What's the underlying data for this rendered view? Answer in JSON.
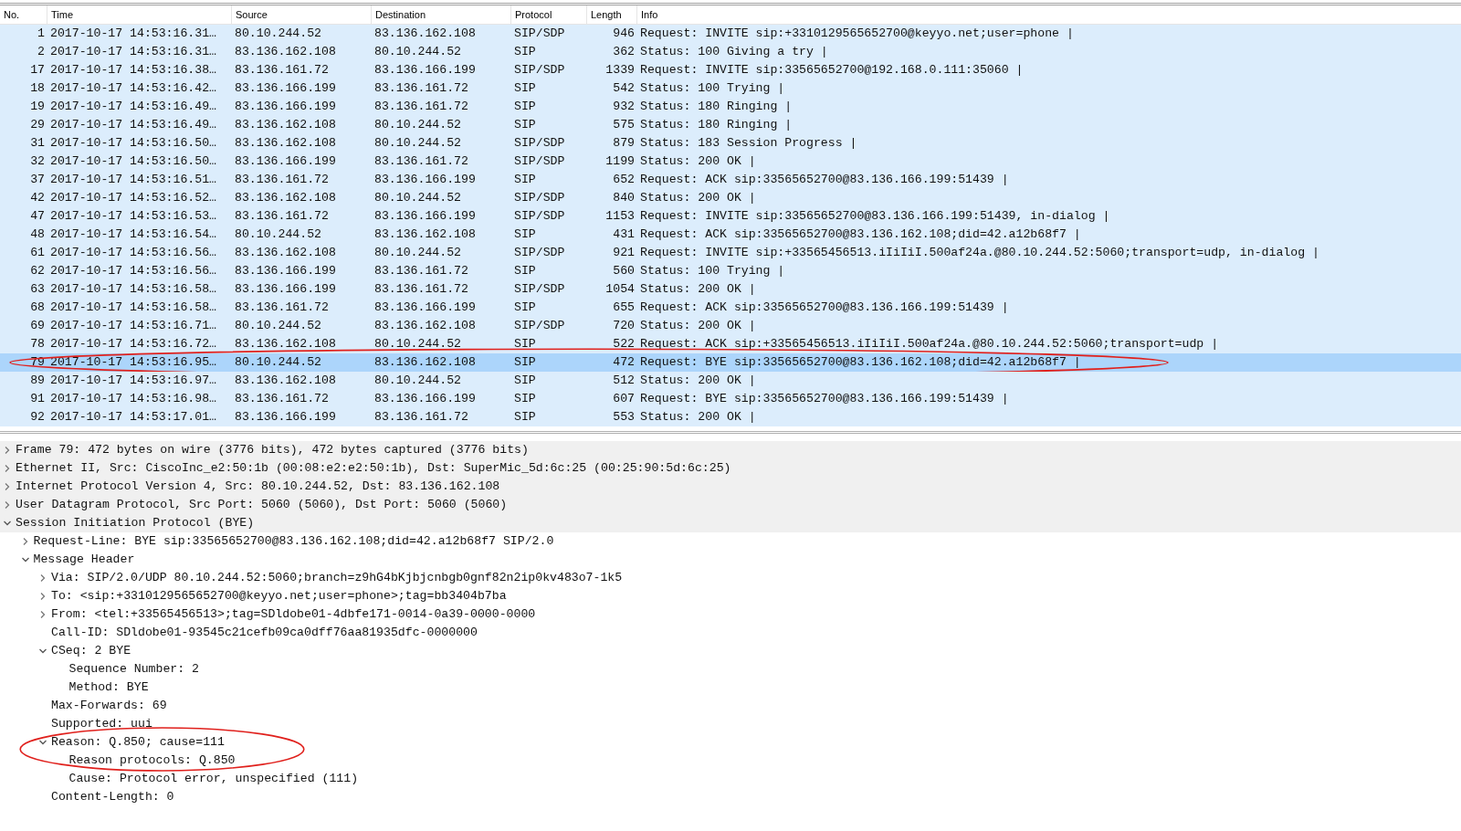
{
  "packet_list": {
    "columns": [
      "No.",
      "Time",
      "Source",
      "Destination",
      "Protocol",
      "Length",
      "Info"
    ],
    "rows": [
      {
        "no": "1",
        "time": "2017-10-17 14:53:16.31…",
        "source": "80.10.244.52",
        "destination": "83.136.162.108",
        "protocol": "SIP/SDP",
        "length": "946",
        "info": "Request: INVITE sip:+3310129565652700@keyyo.net;user=phone |",
        "selected": false,
        "circled": false
      },
      {
        "no": "2",
        "time": "2017-10-17 14:53:16.31…",
        "source": "83.136.162.108",
        "destination": "80.10.244.52",
        "protocol": "SIP",
        "length": "362",
        "info": "Status: 100 Giving a try |",
        "selected": false,
        "circled": false
      },
      {
        "no": "17",
        "time": "2017-10-17 14:53:16.38…",
        "source": "83.136.161.72",
        "destination": "83.136.166.199",
        "protocol": "SIP/SDP",
        "length": "1339",
        "info": "Request: INVITE sip:33565652700@192.168.0.111:35060 |",
        "selected": false,
        "circled": false
      },
      {
        "no": "18",
        "time": "2017-10-17 14:53:16.42…",
        "source": "83.136.166.199",
        "destination": "83.136.161.72",
        "protocol": "SIP",
        "length": "542",
        "info": "Status: 100 Trying |",
        "selected": false,
        "circled": false
      },
      {
        "no": "19",
        "time": "2017-10-17 14:53:16.49…",
        "source": "83.136.166.199",
        "destination": "83.136.161.72",
        "protocol": "SIP",
        "length": "932",
        "info": "Status: 180 Ringing |",
        "selected": false,
        "circled": false
      },
      {
        "no": "29",
        "time": "2017-10-17 14:53:16.49…",
        "source": "83.136.162.108",
        "destination": "80.10.244.52",
        "protocol": "SIP",
        "length": "575",
        "info": "Status: 180 Ringing |",
        "selected": false,
        "circled": false
      },
      {
        "no": "31",
        "time": "2017-10-17 14:53:16.50…",
        "source": "83.136.162.108",
        "destination": "80.10.244.52",
        "protocol": "SIP/SDP",
        "length": "879",
        "info": "Status: 183 Session Progress |",
        "selected": false,
        "circled": false
      },
      {
        "no": "32",
        "time": "2017-10-17 14:53:16.50…",
        "source": "83.136.166.199",
        "destination": "83.136.161.72",
        "protocol": "SIP/SDP",
        "length": "1199",
        "info": "Status: 200 OK |",
        "selected": false,
        "circled": false
      },
      {
        "no": "37",
        "time": "2017-10-17 14:53:16.51…",
        "source": "83.136.161.72",
        "destination": "83.136.166.199",
        "protocol": "SIP",
        "length": "652",
        "info": "Request: ACK sip:33565652700@83.136.166.199:51439 |",
        "selected": false,
        "circled": false
      },
      {
        "no": "42",
        "time": "2017-10-17 14:53:16.52…",
        "source": "83.136.162.108",
        "destination": "80.10.244.52",
        "protocol": "SIP/SDP",
        "length": "840",
        "info": "Status: 200 OK |",
        "selected": false,
        "circled": false
      },
      {
        "no": "47",
        "time": "2017-10-17 14:53:16.53…",
        "source": "83.136.161.72",
        "destination": "83.136.166.199",
        "protocol": "SIP/SDP",
        "length": "1153",
        "info": "Request: INVITE sip:33565652700@83.136.166.199:51439, in-dialog |",
        "selected": false,
        "circled": false
      },
      {
        "no": "48",
        "time": "2017-10-17 14:53:16.54…",
        "source": "80.10.244.52",
        "destination": "83.136.162.108",
        "protocol": "SIP",
        "length": "431",
        "info": "Request: ACK sip:33565652700@83.136.162.108;did=42.a12b68f7 |",
        "selected": false,
        "circled": false
      },
      {
        "no": "61",
        "time": "2017-10-17 14:53:16.56…",
        "source": "83.136.162.108",
        "destination": "80.10.244.52",
        "protocol": "SIP/SDP",
        "length": "921",
        "info": "Request: INVITE sip:+33565456513.iIiIiI.500af24a.@80.10.244.52:5060;transport=udp, in-dialog |",
        "selected": false,
        "circled": false
      },
      {
        "no": "62",
        "time": "2017-10-17 14:53:16.56…",
        "source": "83.136.166.199",
        "destination": "83.136.161.72",
        "protocol": "SIP",
        "length": "560",
        "info": "Status: 100 Trying |",
        "selected": false,
        "circled": false
      },
      {
        "no": "63",
        "time": "2017-10-17 14:53:16.58…",
        "source": "83.136.166.199",
        "destination": "83.136.161.72",
        "protocol": "SIP/SDP",
        "length": "1054",
        "info": "Status: 200 OK |",
        "selected": false,
        "circled": false
      },
      {
        "no": "68",
        "time": "2017-10-17 14:53:16.58…",
        "source": "83.136.161.72",
        "destination": "83.136.166.199",
        "protocol": "SIP",
        "length": "655",
        "info": "Request: ACK sip:33565652700@83.136.166.199:51439 |",
        "selected": false,
        "circled": false
      },
      {
        "no": "69",
        "time": "2017-10-17 14:53:16.71…",
        "source": "80.10.244.52",
        "destination": "83.136.162.108",
        "protocol": "SIP/SDP",
        "length": "720",
        "info": "Status: 200 OK |",
        "selected": false,
        "circled": false
      },
      {
        "no": "78",
        "time": "2017-10-17 14:53:16.72…",
        "source": "83.136.162.108",
        "destination": "80.10.244.52",
        "protocol": "SIP",
        "length": "522",
        "info": "Request: ACK sip:+33565456513.iIiIiI.500af24a.@80.10.244.52:5060;transport=udp |",
        "selected": false,
        "circled": false
      },
      {
        "no": "79",
        "time": "2017-10-17 14:53:16.95…",
        "source": "80.10.244.52",
        "destination": "83.136.162.108",
        "protocol": "SIP",
        "length": "472",
        "info": "Request: BYE sip:33565652700@83.136.162.108;did=42.a12b68f7 |",
        "selected": true,
        "circled": true
      },
      {
        "no": "89",
        "time": "2017-10-17 14:53:16.97…",
        "source": "83.136.162.108",
        "destination": "80.10.244.52",
        "protocol": "SIP",
        "length": "512",
        "info": "Status: 200 OK |",
        "selected": false,
        "circled": false
      },
      {
        "no": "91",
        "time": "2017-10-17 14:53:16.98…",
        "source": "83.136.161.72",
        "destination": "83.136.166.199",
        "protocol": "SIP",
        "length": "607",
        "info": "Request: BYE sip:33565652700@83.136.166.199:51439 |",
        "selected": false,
        "circled": false
      },
      {
        "no": "92",
        "time": "2017-10-17 14:53:17.01…",
        "source": "83.136.166.199",
        "destination": "83.136.161.72",
        "protocol": "SIP",
        "length": "553",
        "info": "Status: 200 OK |",
        "selected": false,
        "circled": false
      }
    ]
  },
  "packet_details": [
    {
      "text": "Frame 79: 472 bytes on wire (3776 bits), 472 bytes captured (3776 bits)",
      "expanded": false,
      "circled": false
    },
    {
      "text": "Ethernet II, Src: CiscoInc_e2:50:1b (00:08:e2:e2:50:1b), Dst: SuperMic_5d:6c:25 (00:25:90:5d:6c:25)",
      "expanded": false,
      "circled": false
    },
    {
      "text": "Internet Protocol Version 4, Src: 80.10.244.52, Dst: 83.136.162.108",
      "expanded": false,
      "circled": false
    },
    {
      "text": "User Datagram Protocol, Src Port: 5060 (5060), Dst Port: 5060 (5060)",
      "expanded": false,
      "circled": false
    },
    {
      "text": "Session Initiation Protocol (BYE)",
      "expanded": true,
      "circled": false,
      "children": [
        {
          "text": "Request-Line: BYE sip:33565652700@83.136.162.108;did=42.a12b68f7 SIP/2.0",
          "expanded": false,
          "circled": false
        },
        {
          "text": "Message Header",
          "expanded": true,
          "circled": false,
          "children": [
            {
              "text": "Via: SIP/2.0/UDP 80.10.244.52:5060;branch=z9hG4bKjbjcnbgb0gnf82n2ip0kv483o7-1k5",
              "expanded": false,
              "circled": false
            },
            {
              "text": "To: <sip:+3310129565652700@keyyo.net;user=phone>;tag=bb3404b7ba",
              "expanded": false,
              "circled": false
            },
            {
              "text": "From: <tel:+33565456513>;tag=SDldobe01-4dbfe171-0014-0a39-0000-0000",
              "expanded": false,
              "circled": false
            },
            {
              "text": "Call-ID: SDldobe01-93545c21cefb09ca0dff76aa81935dfc-0000000",
              "circled": false
            },
            {
              "text": "CSeq: 2 BYE",
              "expanded": true,
              "circled": false,
              "children": [
                {
                  "text": "Sequence Number: 2",
                  "circled": false
                },
                {
                  "text": "Method: BYE",
                  "circled": false
                }
              ]
            },
            {
              "text": "Max-Forwards: 69",
              "circled": false
            },
            {
              "text": "Supported: uui",
              "circled": false
            },
            {
              "text": "Reason: Q.850; cause=111",
              "expanded": true,
              "circled": true,
              "children": [
                {
                  "text": "Reason protocols: Q.850",
                  "circled": false
                },
                {
                  "text": "Cause: Protocol error, unspecified (111)",
                  "circled": false
                }
              ]
            },
            {
              "text": "Content-Length: 0",
              "circled": false
            }
          ]
        }
      ]
    }
  ]
}
